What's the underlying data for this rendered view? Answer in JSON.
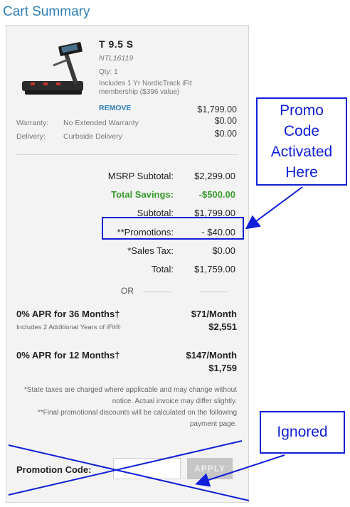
{
  "header": {
    "title": "Cart Summary"
  },
  "product": {
    "name": "T 9.5 S",
    "sku": "NTL16119",
    "qty": "Qty: 1",
    "includes": "Includes 1 Yr NordicTrack iFit membership ($396 value)",
    "remove_label": "REMOVE",
    "price": "$1,799.00"
  },
  "warranty": {
    "label": "Warranty:",
    "value": "No Extended Warranty",
    "amount": "$0.00"
  },
  "delivery": {
    "label": "Delivery:",
    "value": "Curbside Delivery",
    "amount": "$0.00"
  },
  "summary": {
    "msrp_label": "MSRP Subtotal:",
    "msrp_value": "$2,299.00",
    "savings_label": "Total Savings:",
    "savings_value": "-$500.00",
    "subtotal_label": "Subtotal:",
    "subtotal_value": "$1,799.00",
    "promotions_label": "**Promotions:",
    "promotions_value": "- $40.00",
    "tax_label": "*Sales Tax:",
    "tax_value": "$0.00",
    "total_label": "Total:",
    "total_value": "$1,759.00"
  },
  "or_text": "OR",
  "financing": [
    {
      "title": "0% APR for 36 Months†",
      "sub": "Includes 2 Additional Years of iFit®",
      "monthly": "$71/Month",
      "total": "$2,551"
    },
    {
      "title": "0% APR for 12 Months†",
      "sub": "",
      "monthly": "$147/Month",
      "total": "$1,759"
    }
  ],
  "notes": {
    "line1": "*State taxes are charged where applicable and may change without notice. Actual invoice may differ slightly.",
    "line2": "**Final promotional discounts will be calculated on the following payment page."
  },
  "promo": {
    "label": "Promotion Code:",
    "value": "",
    "apply_label": "APPLY"
  },
  "annotations": {
    "callout_promo": [
      "Promo",
      "Code",
      "Activated",
      "Here"
    ],
    "callout_ignored": "Ignored"
  },
  "colors": {
    "accent": "#2e7fb8",
    "savings": "#3a9b2e",
    "annotation": "#1020d8"
  }
}
